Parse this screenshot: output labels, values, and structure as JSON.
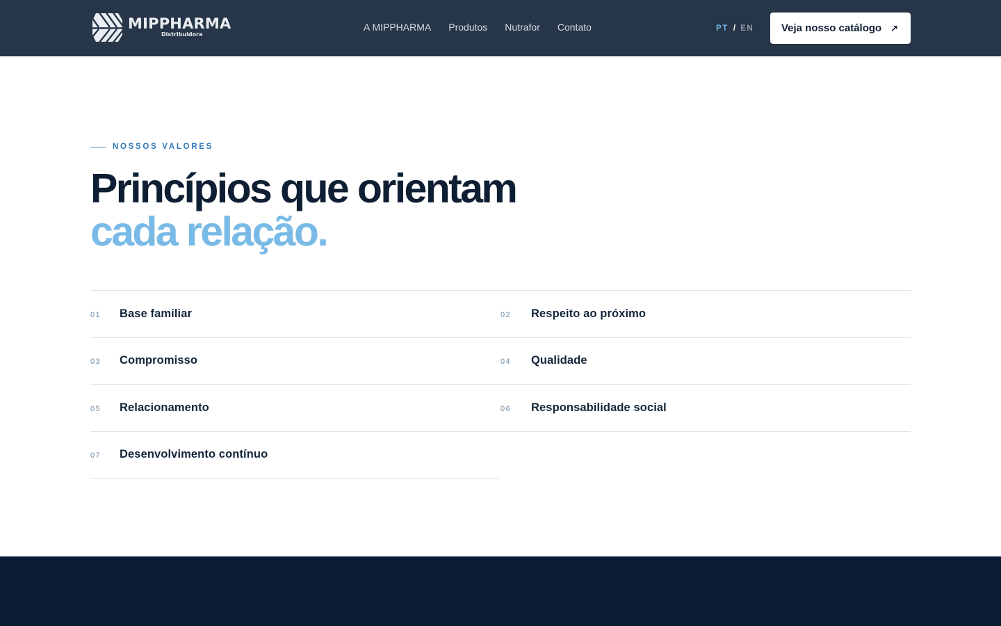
{
  "header": {
    "logo": {
      "name": "MIPPHARMA",
      "subtitle": "Distribuidora"
    },
    "nav": [
      "A MIPPHARMA",
      "Produtos",
      "Nutrafor",
      "Contato"
    ],
    "language": {
      "active": "PT",
      "separator": "/",
      "other": "EN"
    },
    "cta": {
      "label": "Veja nosso catálogo",
      "icon": "↗"
    }
  },
  "section": {
    "eyebrow": "NOSSOS VALORES",
    "title_line1": "Princípios que orientam",
    "title_line2": "cada relação.",
    "values": [
      {
        "number": "01",
        "label": "Base familiar"
      },
      {
        "number": "02",
        "label": "Respeito ao próximo"
      },
      {
        "number": "03",
        "label": "Compromisso"
      },
      {
        "number": "04",
        "label": "Qualidade"
      },
      {
        "number": "05",
        "label": "Relacionamento"
      },
      {
        "number": "06",
        "label": "Responsabilidade social"
      },
      {
        "number": "07",
        "label": "Desenvolvimento contínuo"
      }
    ]
  },
  "colors": {
    "header_bg": "#263547",
    "footer_bg": "#0a1b34",
    "accent": "#79bbe6",
    "eyebrow": "#2f78b8",
    "heading": "#0f1f33"
  }
}
